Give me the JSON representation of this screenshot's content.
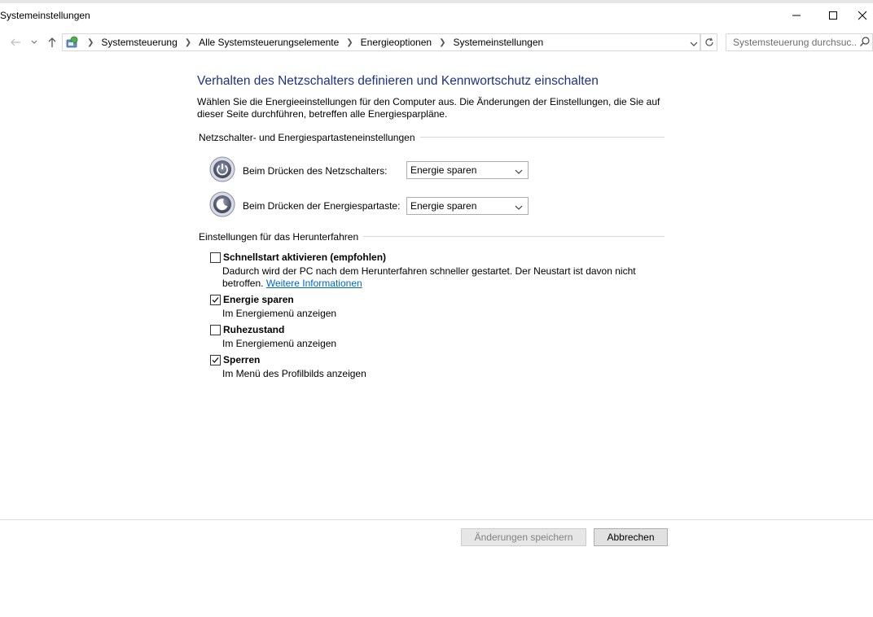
{
  "window": {
    "title": "Systemeinstellungen"
  },
  "address": {
    "breadcrumbs": [
      "Systemsteuerung",
      "Alle Systemsteuerungselemente",
      "Energieoptionen",
      "Systemeinstellungen"
    ],
    "search_placeholder": "Systemsteuerung durchsuc..."
  },
  "main": {
    "heading": "Verhalten des Netzschalters definieren und Kennwortschutz einschalten",
    "intro": "Wählen Sie die Energieeinstellungen für den Computer aus. Die Änderungen der Einstellungen, die Sie auf dieser Seite durchführen, betreffen alle Energiesparpläne.",
    "power_group_title": "Netzschalter- und Energiespartasteneinstellungen",
    "power_rows": [
      {
        "label": "Beim Drücken des Netzschalters:",
        "value": "Energie sparen",
        "icon": "power-button-icon"
      },
      {
        "label": "Beim Drücken der Energiespartaste:",
        "value": "Energie sparen",
        "icon": "sleep-button-icon"
      }
    ],
    "shutdown_group_title": "Einstellungen für das Herunterfahren",
    "shutdown_options": [
      {
        "label": "Schnellstart aktivieren (empfohlen)",
        "checked": false,
        "desc1": "Dadurch wird der PC nach dem Herunterfahren schneller gestartet. Der Neustart ist davon nicht",
        "desc2": "betroffen.",
        "link": "Weitere Informationen"
      },
      {
        "label": "Energie sparen",
        "checked": true,
        "desc": "Im Energiemenü anzeigen"
      },
      {
        "label": "Ruhezustand",
        "checked": false,
        "desc": "Im Energiemenü anzeigen"
      },
      {
        "label": "Sperren",
        "checked": true,
        "desc": "Im Menü des Profilbilds anzeigen"
      }
    ]
  },
  "footer": {
    "save_label": "Änderungen speichern",
    "cancel_label": "Abbrechen"
  },
  "colors": {
    "heading": "#1e3287",
    "link": "#0066cc"
  }
}
